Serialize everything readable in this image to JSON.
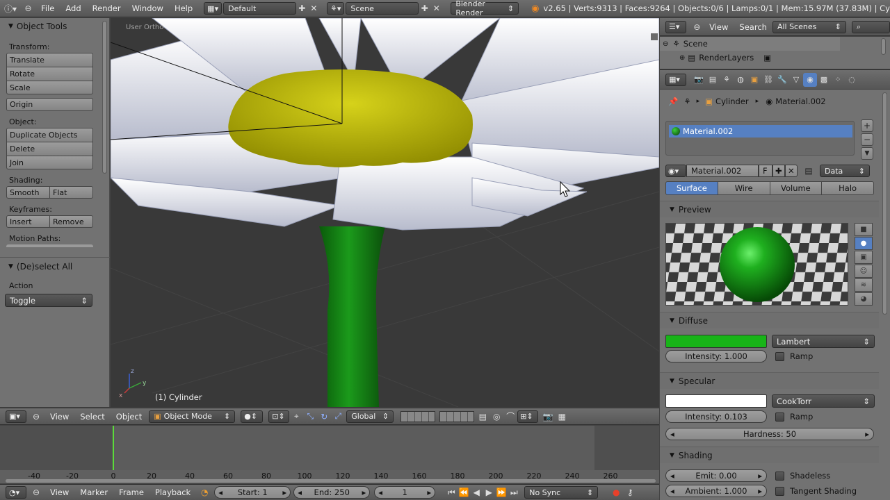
{
  "topbar": {
    "menus": [
      "File",
      "Add",
      "Render",
      "Window",
      "Help"
    ],
    "layout": "Default",
    "scene": "Scene",
    "engine": "Blender Render",
    "stats": "v2.65 | Verts:9313 | Faces:9264 | Objects:0/6 | Lamps:0/1 | Mem:15.97M (37.83M) | Cy"
  },
  "toolshelf": {
    "title": "Object Tools",
    "transform_label": "Transform:",
    "translate": "Translate",
    "rotate": "Rotate",
    "scale": "Scale",
    "origin": "Origin",
    "object_label": "Object:",
    "duplicate": "Duplicate Objects",
    "delete": "Delete",
    "join": "Join",
    "shading_label": "Shading:",
    "smooth": "Smooth",
    "flat": "Flat",
    "keyframes_label": "Keyframes:",
    "insert": "Insert",
    "remove": "Remove",
    "motion_paths_label": "Motion Paths:",
    "operator_title": "(De)select All",
    "action_label": "Action",
    "action_value": "Toggle"
  },
  "viewport": {
    "view_label": "User Ortho",
    "object_name": "(1) Cylinder",
    "axis_z": "z",
    "axis_y": "y",
    "axis_x": "x"
  },
  "view_header": {
    "menus": [
      "View",
      "Select",
      "Object"
    ],
    "mode": "Object Mode",
    "orientation": "Global"
  },
  "timeline": {
    "ticks": [
      "-40",
      "-20",
      "0",
      "20",
      "40",
      "60",
      "80",
      "100",
      "120",
      "140",
      "160",
      "180",
      "200",
      "220",
      "240",
      "260"
    ],
    "menus": [
      "View",
      "Marker",
      "Frame",
      "Playback"
    ],
    "start": "Start: 1",
    "end": "End: 250",
    "current": "1",
    "sync": "No Sync"
  },
  "outliner": {
    "menus": [
      "View",
      "Search"
    ],
    "filter": "All Scenes",
    "scene": "Scene",
    "render_layers": "RenderLayers"
  },
  "properties": {
    "context_object": "Cylinder",
    "context_material": "Material.002",
    "slot_name": "Material.002",
    "material_name": "Material.002",
    "f_label": "F",
    "link": "Data",
    "tabs": [
      "Surface",
      "Wire",
      "Volume",
      "Halo"
    ],
    "preview_title": "Preview",
    "diffuse_title": "Diffuse",
    "diffuse_color": "#18b418",
    "diffuse_shader": "Lambert",
    "diffuse_intensity": "Intensity: 1.000",
    "ramp": "Ramp",
    "specular_title": "Specular",
    "specular_color": "#ffffff",
    "specular_shader": "CookTorr",
    "specular_intensity": "Intensity: 0.103",
    "hardness": "Hardness: 50",
    "shading_title": "Shading",
    "emit": "Emit: 0.00",
    "ambient": "Ambient: 1.000",
    "shadeless": "Shadeless",
    "tangent_shading": "Tangent Shading"
  }
}
